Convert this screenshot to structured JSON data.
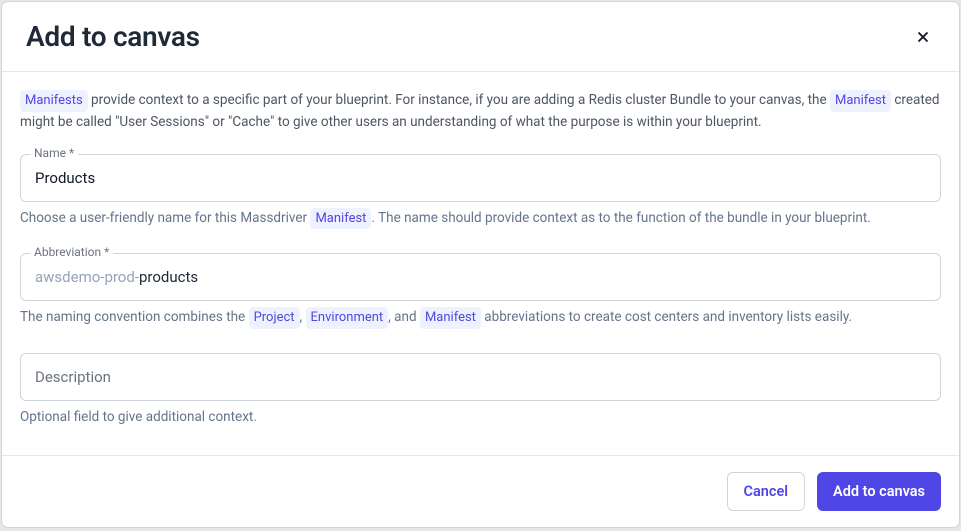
{
  "header": {
    "title": "Add to canvas"
  },
  "intro": {
    "tag1": "Manifests",
    "text1": " provide context to a specific part of your blueprint. For instance, if you are adding a Redis cluster Bundle to your canvas, the ",
    "tag2": "Manifest",
    "text2": " created might be called \"User Sessions\" or \"Cache\" to give other users an understanding of what the purpose is within your blueprint."
  },
  "fields": {
    "name": {
      "label": "Name *",
      "value": "Products",
      "helper_prefix": "Choose a user-friendly name for this Massdriver ",
      "helper_tag": "Manifest",
      "helper_suffix": ". The name should provide context as to the function of the bundle in your blueprint."
    },
    "abbreviation": {
      "label": "Abbreviation *",
      "prefix": "awsdemo-prod-",
      "value": "products",
      "helper_prefix": "The naming convention combines the ",
      "helper_tag1": "Project",
      "helper_sep1": ", ",
      "helper_tag2": "Environment",
      "helper_sep2": ", and ",
      "helper_tag3": "Manifest",
      "helper_suffix": " abbreviations to create cost centers and inventory lists easily."
    },
    "description": {
      "placeholder": "Description",
      "helper": "Optional field to give additional context."
    }
  },
  "footer": {
    "cancel": "Cancel",
    "submit": "Add to canvas"
  }
}
